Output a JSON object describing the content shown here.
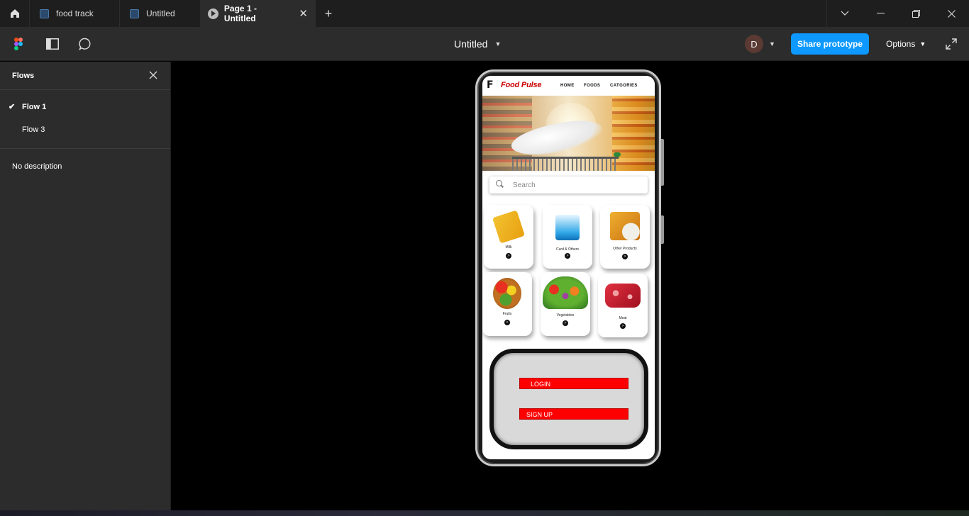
{
  "tabs": [
    {
      "label": "food track"
    },
    {
      "label": "Untitled"
    },
    {
      "label": "Page 1 - Untitled"
    }
  ],
  "toolbar": {
    "doc_title": "Untitled",
    "avatar_initial": "D",
    "share_label": "Share prototype",
    "options_label": "Options"
  },
  "sidebar": {
    "title": "Flows",
    "flows": [
      {
        "label": "Flow 1",
        "selected": true
      },
      {
        "label": "Flow 3",
        "selected": false
      }
    ],
    "description": "No description"
  },
  "app": {
    "brand": "Food Pulse",
    "logo": "F",
    "nav": [
      "HOME",
      "FOODS",
      "CATGORIES"
    ],
    "search_placeholder": "Search",
    "categories": [
      {
        "label": "Milk"
      },
      {
        "label": "Curd & Others"
      },
      {
        "label": "Other Products"
      },
      {
        "label": "Fruits"
      },
      {
        "label": "Vegetables"
      },
      {
        "label": "Meat"
      }
    ],
    "login_label": "LOGIN",
    "signup_label": "SIGN UP",
    "arrow": ">"
  },
  "colors": {
    "accent": "#0d99ff",
    "brand_red": "#c00000",
    "button_red": "#ff0000"
  }
}
